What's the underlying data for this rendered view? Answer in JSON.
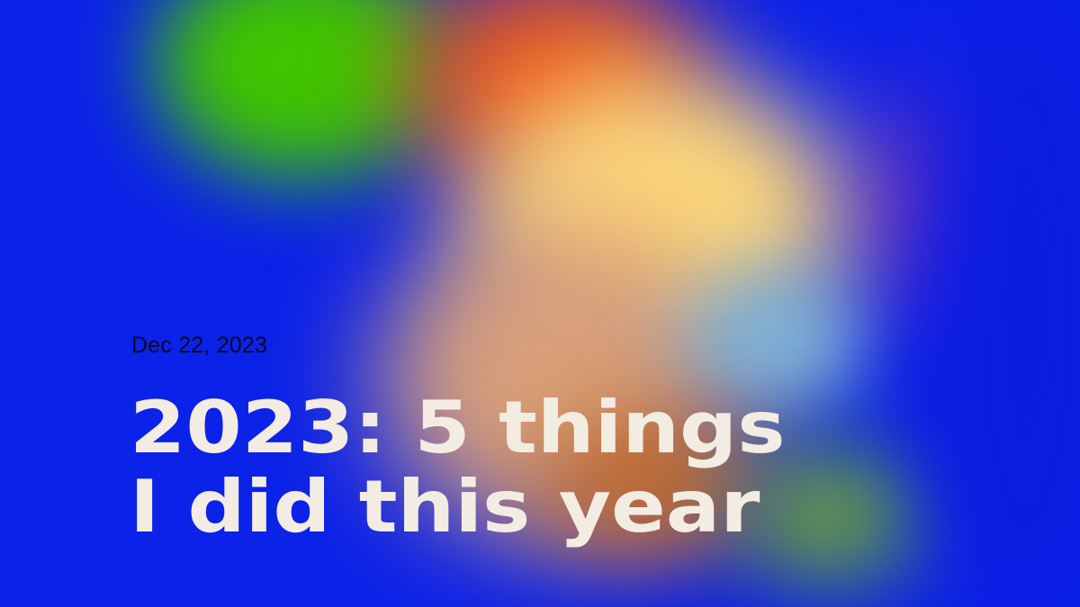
{
  "post": {
    "date": "Dec 22, 2023",
    "title_line_1": "2023: 5 things",
    "title_line_2": "I did this year"
  },
  "colors": {
    "background": "#0b22e8",
    "title_text": "#f3ece3",
    "date_text": "#0a0a23",
    "blob_green": "#3fc400",
    "blob_orange": "#e8581a",
    "blob_yellow": "#ffd97a"
  }
}
